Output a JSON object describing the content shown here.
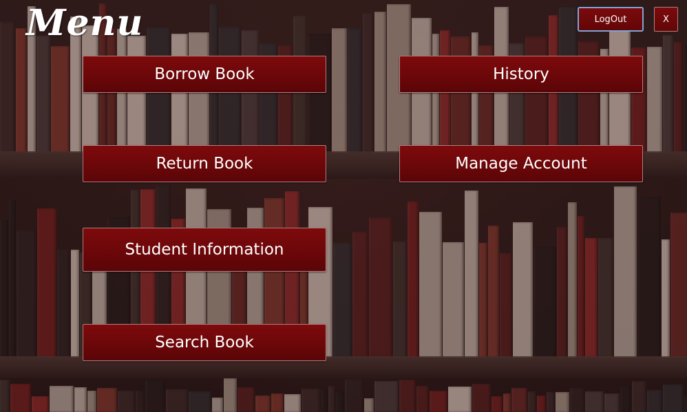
{
  "window": {
    "title": "Menu"
  },
  "header": {
    "logout_label": "LogOut",
    "close_label": "X"
  },
  "menu": {
    "borrow_book": "Borrow Book",
    "history": "History",
    "return_book": "Return Book",
    "manage_account": "Manage Account",
    "student_information": "Student Information",
    "search_book": "Search Book"
  },
  "colors": {
    "button_bg": "#6c0709",
    "button_border": "#b3817f",
    "logout_focus_border": "#7fa6d6",
    "text": "#ffffff",
    "background": "#231817"
  }
}
